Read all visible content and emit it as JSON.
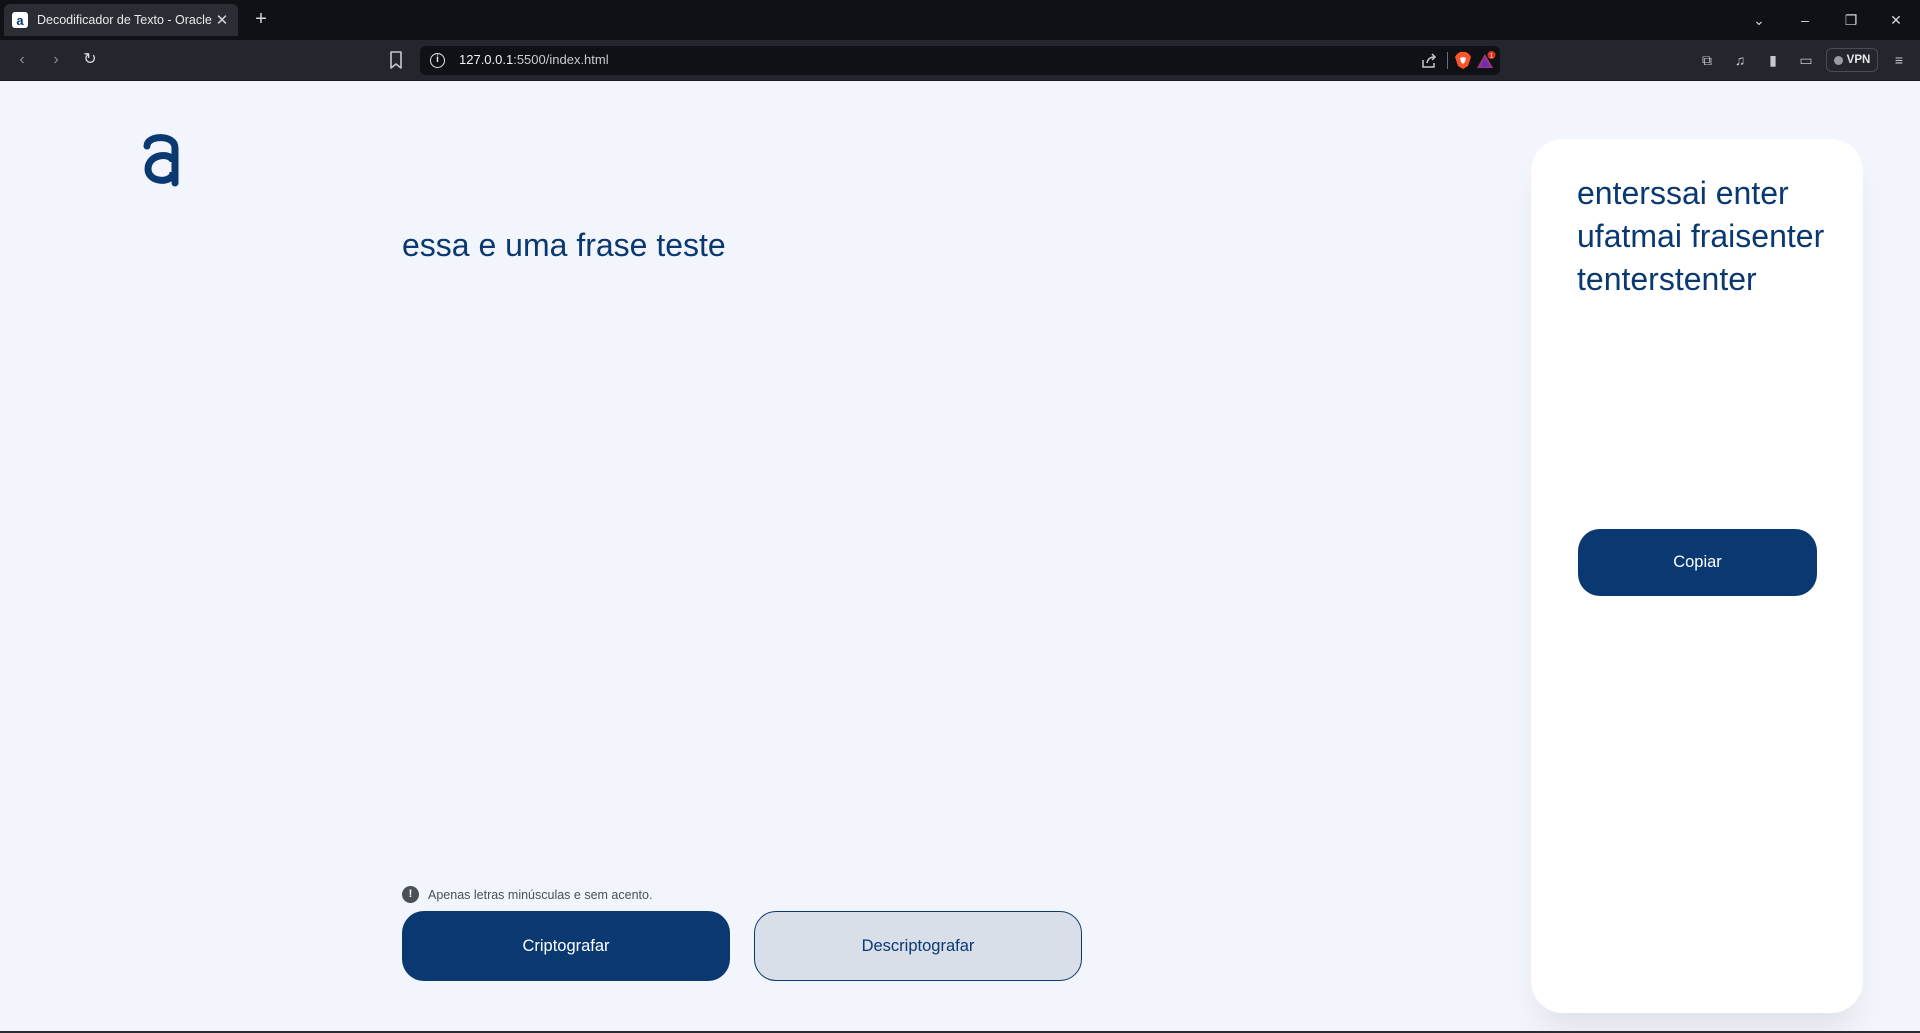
{
  "browser": {
    "tab_title": "Decodificador de Texto - Oracle",
    "tab_close": "✕",
    "new_tab": "+",
    "url_host": "127.0.0.1",
    "url_path": ":5500/index.html",
    "vpn_label": "VPN",
    "rewards_badge": "1"
  },
  "app": {
    "input_text": "essa e uma frase teste",
    "hint": "Apenas letras minúsculas e sem acento.",
    "hint_icon_glyph": "!",
    "encrypt_label": "Criptografar",
    "decrypt_label": "Descriptografar",
    "output_text": "enterssai enter ufatmai fraisenter tenterstenter",
    "copy_label": "Copiar"
  },
  "colors": {
    "brand": "#0a3871",
    "background": "#f3f5fc",
    "secondary_button": "#d8dfe8"
  }
}
